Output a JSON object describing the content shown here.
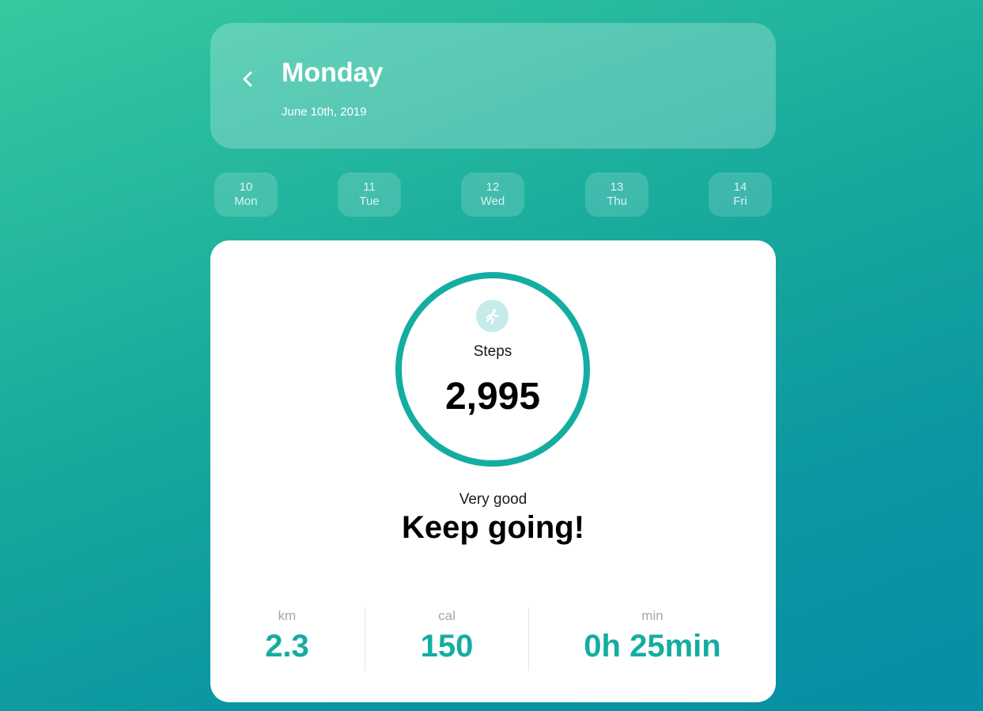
{
  "header": {
    "back_icon": "chevron-left-icon",
    "day": "Monday",
    "date": "June 10th, 2019"
  },
  "days": [
    {
      "num": "10",
      "name": "Mon"
    },
    {
      "num": "11",
      "name": "Tue"
    },
    {
      "num": "12",
      "name": "Wed"
    },
    {
      "num": "13",
      "name": "Thu"
    },
    {
      "num": "14",
      "name": "Fri"
    }
  ],
  "steps": {
    "icon": "running-icon",
    "label": "Steps",
    "value": "2,995"
  },
  "feedback": {
    "rating": "Very good",
    "message": "Keep going!"
  },
  "stats": {
    "distance": {
      "label": "km",
      "value": "2.3"
    },
    "calories": {
      "label": "cal",
      "value": "150"
    },
    "duration": {
      "label": "min",
      "value": "0h 25min"
    }
  },
  "colors": {
    "accent": "#14ada1",
    "gradient_start": "#35c9a0",
    "gradient_end": "#068ea5"
  }
}
